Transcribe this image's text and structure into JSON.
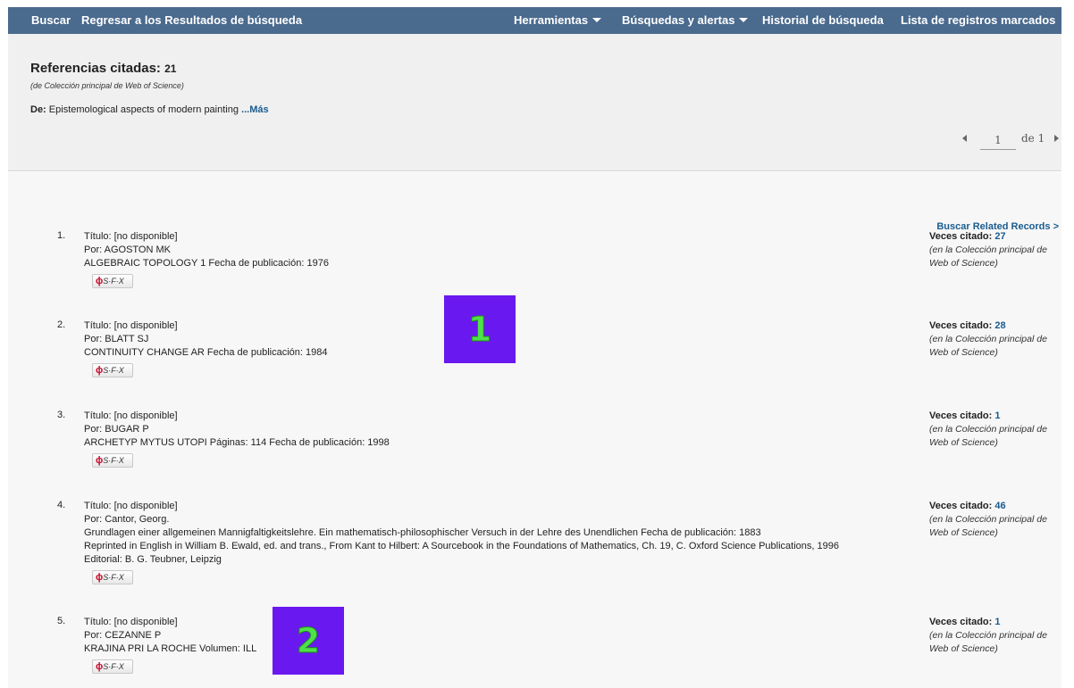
{
  "nav": {
    "buscar": "Buscar",
    "regresar": "Regresar a los Resultados de búsqueda",
    "herramientas": "Herramientas",
    "busquedas_alertas": "Búsquedas y alertas",
    "historial": "Historial de búsqueda",
    "lista_marcados": "Lista de registros marcados"
  },
  "header": {
    "title": "Referencias citadas:",
    "count": "21",
    "source": "(de Colección principal de Web of Science)",
    "from_label": "De:",
    "from_text": "Epistemological aspects of modern painting",
    "more_link": "...Más"
  },
  "pager": {
    "page": "1",
    "of_text": "de 1"
  },
  "related_link": "Buscar Related Records >",
  "records": [
    {
      "num": "1.",
      "lines": [
        "Título: [no disponible]",
        "Por: AGOSTON MK",
        "ALGEBRAIC TOPOLOGY 1   Fecha de publicación: 1976"
      ],
      "cited_label": "Veces citado:",
      "cited_num": "27",
      "cited_note": "(en la Colección principal de Web of Science)"
    },
    {
      "num": "2.",
      "lines": [
        "Título: [no disponible]",
        "Por: BLATT SJ",
        "CONTINUITY CHANGE AR   Fecha de publicación: 1984"
      ],
      "cited_label": "Veces citado:",
      "cited_num": "28",
      "cited_note": "(en la Colección principal de Web of Science)"
    },
    {
      "num": "3.",
      "lines": [
        "Título: [no disponible]",
        "Por: BUGAR P",
        "ARCHETYP MYTUS UTOPI   Páginas: 114   Fecha de publicación: 1998"
      ],
      "cited_label": "Veces citado:",
      "cited_num": "1",
      "cited_note": "(en la Colección principal de Web of Science)"
    },
    {
      "num": "4.",
      "lines": [
        "Título: [no disponible]",
        "Por: Cantor, Georg.",
        "Grundlagen einer allgemeinen Mannigfaltigkeitslehre. Ein mathematisch-philosophischer Versuch in der Lehre des Unendlichen   Fecha de publicación: 1883",
        "Reprinted in English in William B. Ewald, ed. and trans., From Kant to Hilbert: A Sourcebook in the Foundations of Mathematics, Ch. 19, C. Oxford Science Publications, 1996",
        "Editorial: B. G. Teubner, Leipzig"
      ],
      "cited_label": "Veces citado:",
      "cited_num": "46",
      "cited_note": "(en la Colección principal de Web of Science)"
    },
    {
      "num": "5.",
      "lines": [
        "Título: [no disponible]",
        "Por: CEZANNE P",
        "KRAJINA PRI LA ROCHE   Volumen: ILL"
      ],
      "cited_label": "Veces citado:",
      "cited_num": "1",
      "cited_note": "(en la Colección principal de Web of Science)"
    }
  ],
  "sfx_label": "S·F·X",
  "markers": [
    "1",
    "2"
  ],
  "colors": {
    "nav_bg": "#4a6a8e",
    "link": "#1a5c8f",
    "marker_bg": "#6a18f0",
    "marker_text": "#4fe04a"
  }
}
